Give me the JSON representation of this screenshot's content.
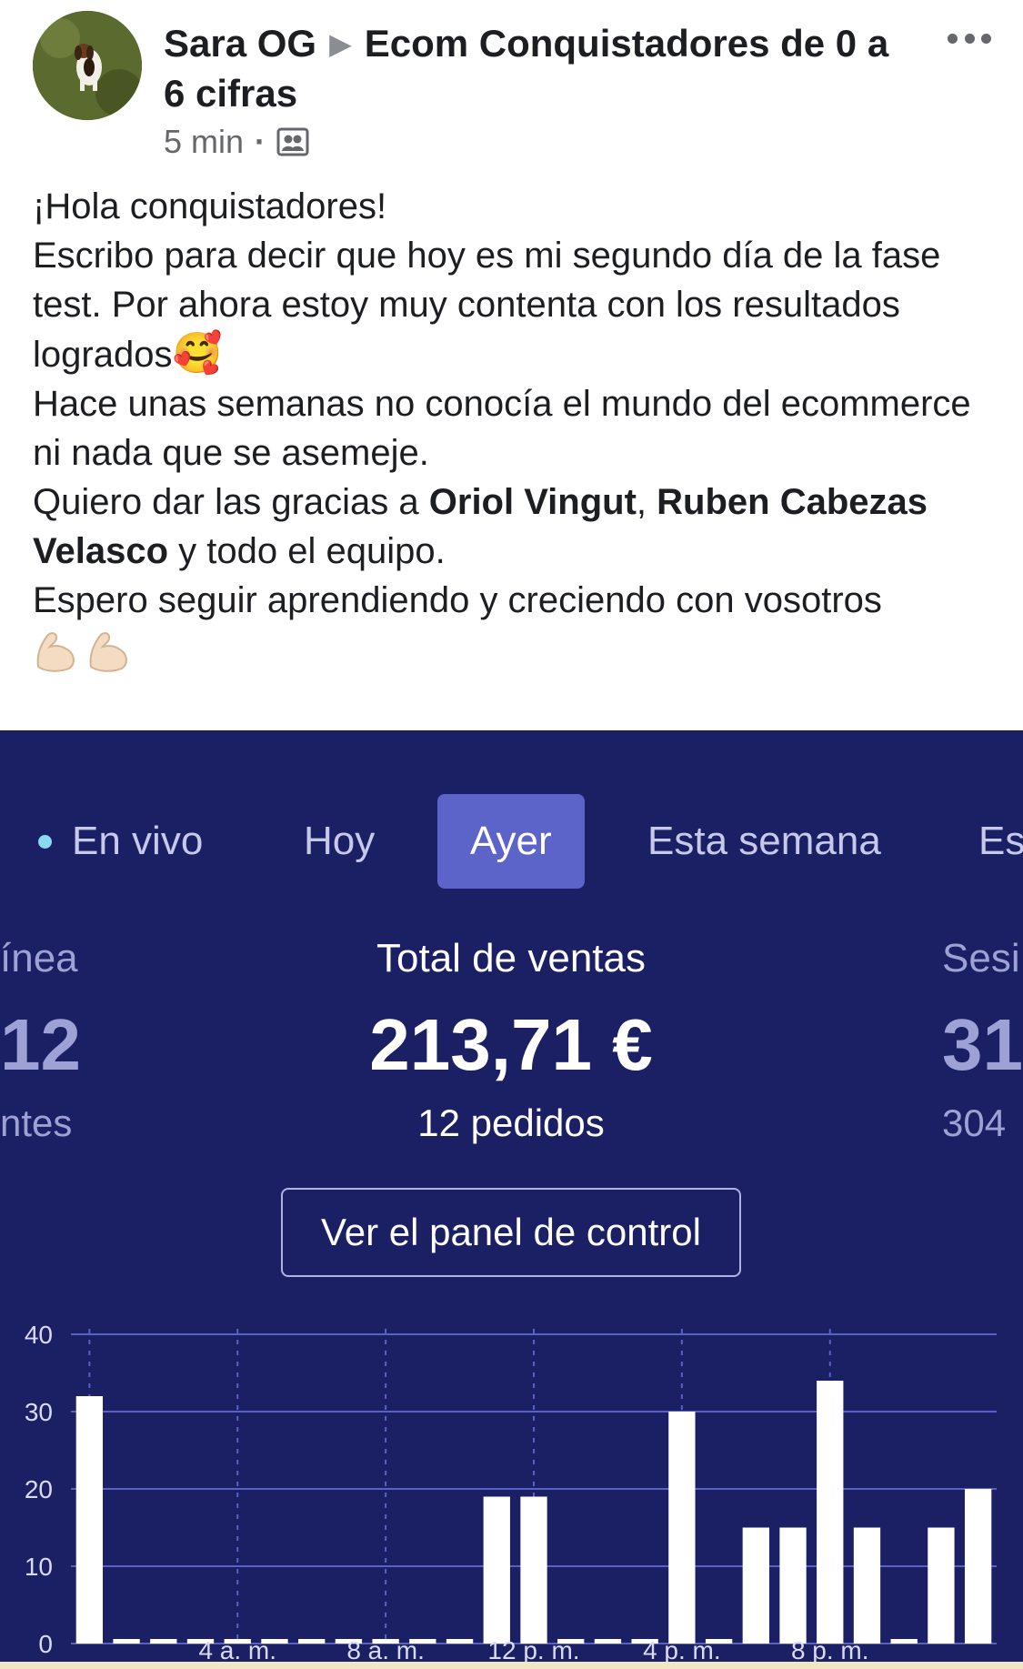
{
  "post": {
    "author": "Sara OG",
    "group": "Ecom Conquistadores de 0 a 6 cifras",
    "time": "5 min",
    "privacy_icon": "group-members-icon",
    "body": {
      "p1": "¡Hola conquistadores!",
      "p2": "Escribo para decir que hoy es mi segundo día de la fase test. Por ahora estoy muy contenta con los resultados logrados",
      "emoji1": "🥰",
      "p3": "Hace unas semanas no conocía el mundo del ecommerce ni nada que se asemeje.",
      "p4_pre": "Quiero dar las gracias a ",
      "mention1": "Oriol Vingut",
      "p4_sep": ", ",
      "mention2": "Ruben Cabezas Velasco",
      "p4_post": " y todo el equipo.",
      "p5": "Espero seguir aprendiendo y creciendo con vosotros"
    }
  },
  "analytics": {
    "tabs": [
      "En vivo",
      "Hoy",
      "Ayer",
      "Esta semana",
      "Es"
    ],
    "active_tab": "Ayer",
    "left_stat": {
      "label": "ínea",
      "value": "12",
      "sub": "ntes"
    },
    "center_stat": {
      "label": "Total de ventas",
      "value": "213,71 €",
      "sub": "12 pedidos"
    },
    "right_stat": {
      "label": "Sesi",
      "value": "31",
      "sub": "304"
    },
    "panel_button": "Ver el panel de control"
  },
  "chart_data": {
    "type": "bar",
    "categories": [
      "0",
      "1",
      "2",
      "3",
      "4",
      "5",
      "6",
      "7",
      "8",
      "9",
      "10",
      "11",
      "12",
      "13",
      "14",
      "15",
      "16",
      "17",
      "18",
      "19",
      "20",
      "21",
      "22",
      "23"
    ],
    "values": [
      32,
      0,
      0,
      0,
      0,
      0,
      0,
      0,
      0,
      0,
      0,
      19,
      19,
      0,
      0,
      0,
      30,
      0,
      15,
      15,
      34,
      15,
      0,
      15,
      20
    ],
    "x_tick_labels": [
      "4 a. m.",
      "8 a. m.",
      "12 p. m.",
      "4 p. m.",
      "8 p. m."
    ],
    "y_ticks": [
      0,
      10,
      20,
      30,
      40
    ],
    "ylim": [
      0,
      40
    ],
    "grid": true,
    "bar_color": "#ffffff",
    "grid_color": "#5a61c4"
  }
}
